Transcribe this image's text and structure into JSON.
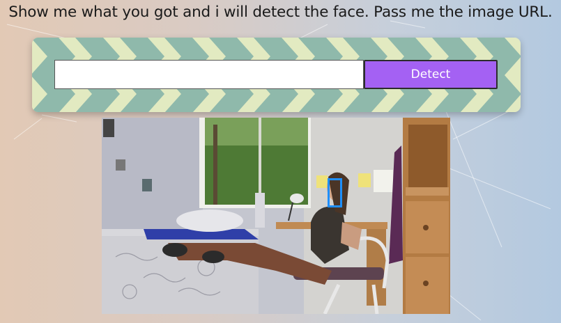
{
  "prompt": {
    "text": "Show me what you got and i will detect the face. Pass me the image URL."
  },
  "form": {
    "url_input": {
      "value": "",
      "placeholder": ""
    },
    "detect_button_label": "Detect"
  },
  "result": {
    "image_alt": "Person sitting in a bedroom chair by a window",
    "faces_detected": 1
  },
  "colors": {
    "button": "#a461f3",
    "face_box": "#1e8fff",
    "pattern_light": "#e2eac1",
    "pattern_dark": "#8fb9ab"
  }
}
